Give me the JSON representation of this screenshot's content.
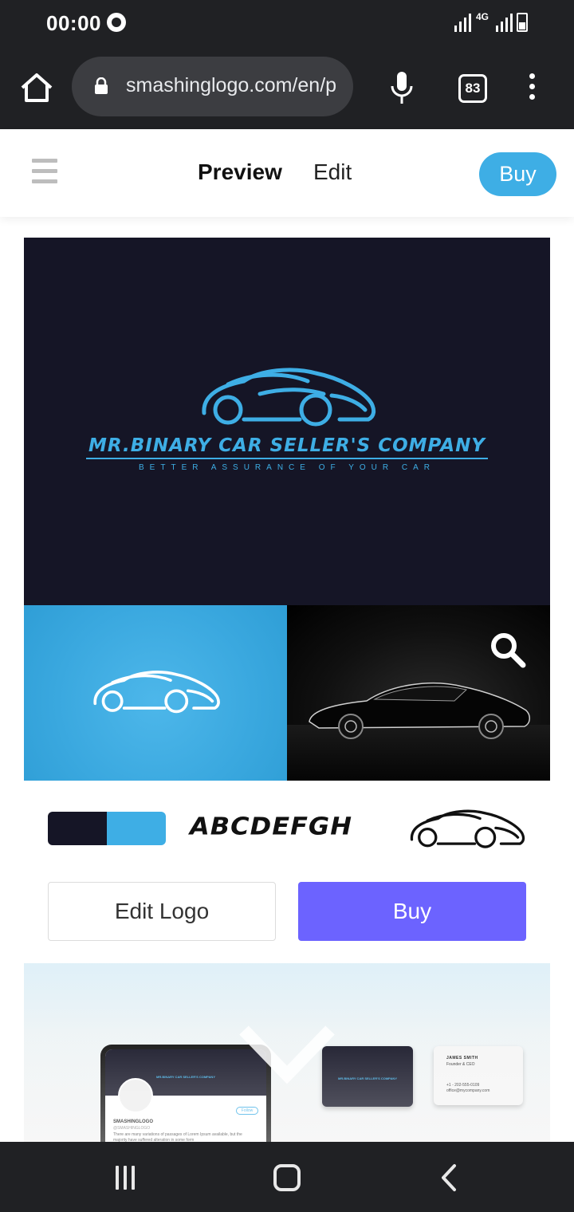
{
  "status_bar": {
    "time": "00:00",
    "network": "4G"
  },
  "browser": {
    "url": "smashinglogo.com/en/p",
    "tab_count": "83"
  },
  "site_nav": {
    "preview_label": "Preview",
    "edit_label": "Edit",
    "buy_label": "Buy"
  },
  "logo": {
    "company_name": "MR.BINARY CAR SELLER'S COMPANY",
    "slogan": "BETTER ASSURANCE OF YOUR CAR",
    "colors": {
      "primary": "#151526",
      "accent": "#3eaee5"
    }
  },
  "style_row": {
    "font_sample": "ABCDEFGH"
  },
  "actions": {
    "edit_logo_label": "Edit Logo",
    "buy_label": "Buy"
  },
  "mockup": {
    "profile_name": "SMASHINGLOGO",
    "profile_handle": "@SMASHINGLOGO",
    "follow_label": "Follow",
    "profile_text": "There are many variations of passages of Lorem Ipsum available, but the majority have suffered alteration in some form",
    "card_name": "JAMES SMITH",
    "card_title": "Founder & CEO",
    "card_phone": "+1 - 202-555-0109",
    "card_email": "office@mycompany.com"
  },
  "accent_colors": {
    "buy_pill": "#3eaee5",
    "buy_button": "#6c63ff"
  }
}
